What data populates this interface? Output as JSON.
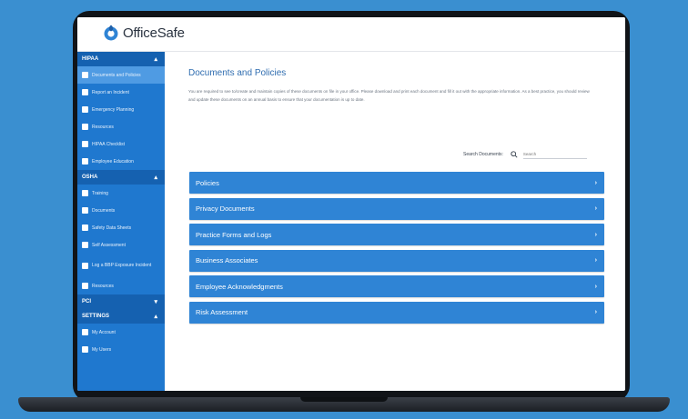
{
  "app": {
    "logo_text": "OfficeSafe"
  },
  "sidebar": {
    "sections": [
      {
        "title": "HIPAA",
        "items": [
          {
            "label": "Documents and Policies",
            "icon": "document-icon",
            "active": true
          },
          {
            "label": "Report an Incident",
            "icon": "report-icon"
          },
          {
            "label": "Emergency Planning",
            "icon": "warning-icon"
          },
          {
            "label": "Resources",
            "icon": "resources-icon"
          },
          {
            "label": "HIPAA Checklist",
            "icon": "checklist-icon"
          },
          {
            "label": "Employee Education",
            "icon": "education-icon"
          }
        ]
      },
      {
        "title": "OSHA",
        "items": [
          {
            "label": "Training",
            "icon": "training-icon"
          },
          {
            "label": "Documents",
            "icon": "document-icon"
          },
          {
            "label": "Safety Data Sheets",
            "icon": "safety-icon"
          },
          {
            "label": "Self Assessment",
            "icon": "checklist-icon"
          },
          {
            "label": "Log a BBP Exposure Incident",
            "icon": "log-icon"
          },
          {
            "label": "Resources",
            "icon": "resources-icon"
          }
        ]
      },
      {
        "title": "PCI",
        "items": []
      },
      {
        "title": "SETTINGS",
        "items": [
          {
            "label": "My Account",
            "icon": "account-icon"
          },
          {
            "label": "My Users",
            "icon": "users-icon"
          }
        ]
      }
    ]
  },
  "main": {
    "title": "Documents and Policies",
    "intro": "You are required to see to/create and maintain copies of these documents on file in your office. Please download and print each document and fill it out with the appropriate information. As a best practice, you should review and update these documents on an annual basis to ensure that your documentation is up to date.",
    "search": {
      "label": "Search Documents:",
      "placeholder": "Search"
    },
    "accordion": [
      {
        "label": "Policies"
      },
      {
        "label": "Privacy Documents"
      },
      {
        "label": "Practice Forms and Logs"
      },
      {
        "label": "Business Associates"
      },
      {
        "label": "Employee Acknowledgments"
      },
      {
        "label": "Risk Assessment"
      }
    ]
  },
  "colors": {
    "background": "#3a8fd0",
    "sidebar": "#1f78cf",
    "sidebar_header": "#1561b0",
    "sidebar_active": "#4f9be3",
    "accordion": "#2f84d5",
    "title": "#2f6db0"
  }
}
